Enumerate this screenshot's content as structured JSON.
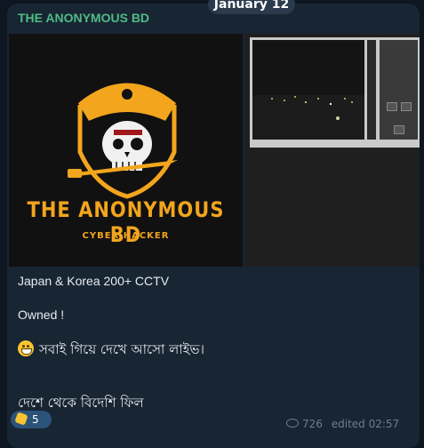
{
  "date_separator": "January 12",
  "message": {
    "sender": "THE ANONYMOUS BD",
    "poster": {
      "title": "THE ANONYMOUS BD",
      "subtitle": "CYBER HACKER"
    },
    "lines": [
      "Japan & Korea 200+ CCTV",
      "Owned !",
      "সবাই গিয়ে দেখে আসো লাইভ।",
      "দেশে থেকে বিদেশি ফিল"
    ],
    "reaction": {
      "icon": "clapping-hands-icon",
      "count": "5"
    },
    "meta": {
      "views": "726",
      "status": "edited 02:57"
    }
  },
  "colors": {
    "background": "#0e1621",
    "bubble": "#182533",
    "sender": "#4fbb86",
    "poster_accent": "#f2a51d"
  }
}
